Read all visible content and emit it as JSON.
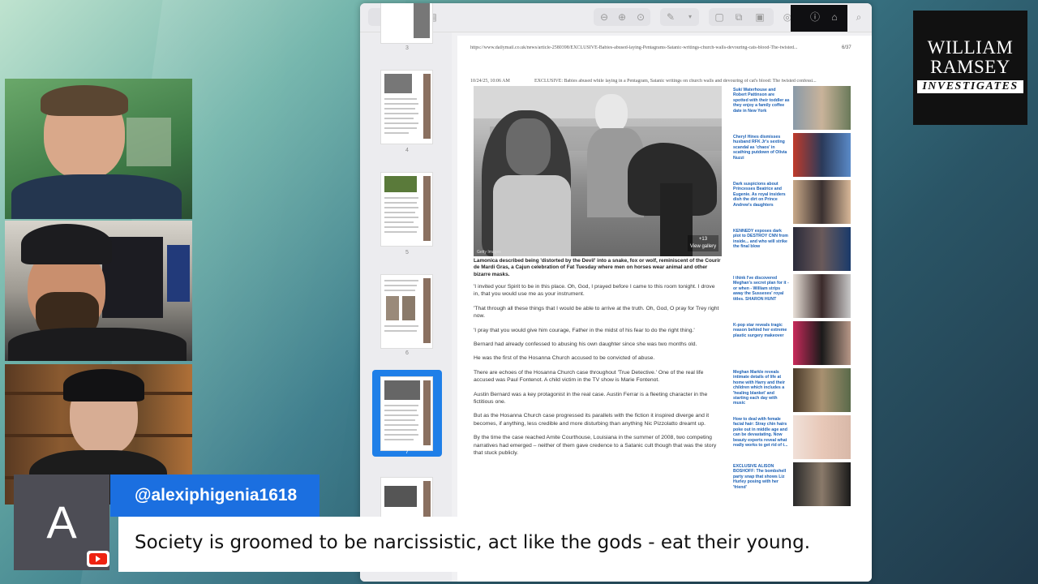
{
  "logo": {
    "line1": "WILLIAM",
    "line2": "RAMSEY",
    "line3": "INVESTIGATES"
  },
  "viewer": {
    "toolbar": {
      "icons": [
        "sidebar-icon",
        "view-menu-icon",
        "zoom-out-icon",
        "zoom-in-icon",
        "zoom-fit-icon",
        "pen-icon",
        "chevron-down-icon",
        "rotate-icon",
        "share-icon",
        "markup-icon",
        "info-icon",
        "export-icon",
        "search-icon"
      ]
    },
    "thumbnails": [
      {
        "page": "3"
      },
      {
        "page": "4"
      },
      {
        "page": "5"
      },
      {
        "page": "6"
      },
      {
        "page": "7",
        "selected": true
      },
      {
        "page": ""
      }
    ],
    "page": {
      "url": "https://www.dailymail.co.uk/news/article-2580398/EXCLUSIVE-Babies-abused-laying-Pentagrams-Satanic-writings-church-walls-devouring-cats-blood-The-twisted...",
      "page_count": "6/37",
      "date": "10/24/25, 10:06 AM",
      "title": "EXCLUSIVE: Babies abused while laying in a Pentagram, Satanic writings on church walls and devouring of cat's blood: The twisted confessi...",
      "photo_credit": "Getty Images",
      "photo_more": "+13",
      "photo_more_label": "View gallery",
      "caption": "Lamonica described being 'distorted by the Devil' into a snake, fox or wolf, reminiscent of the Courir de Mardi Gras, a Cajun celebration of Fat Tuesday where men on horses wear animal and other bizarre masks.",
      "paragraphs": [
        "'I invited your Spirit to be in this place. Oh, God, I prayed before I came to this room tonight. I drove in, that you would use me as your instrument.",
        "'That through all these things that I would be able to arrive at the truth. Oh, God, O pray for Trey right now.",
        "'I pray that you would give him courage, Father in the midst of his fear to do the right thing.'",
        "Bernard had already confessed to abusing his own daughter since she was two months old.",
        "He was the first of the Hosanna Church accused to be convicted of abuse.",
        "There are echoes of the Hosanna Church case throughout 'True Detective.' One of the real life accused was Paul Fontenot. A child victim in the TV show is Marie Fontenot.",
        "Austin Bernard was a key protagonist in the real case. Austin Ferrar is a fleeting character in the fictitious one.",
        "But as the Hosanna Church case progressed its parallels with the fiction it inspired diverge and it becomes, if anything, less credible and more disturbing than anything Nic Pizzolatto dreamt up.",
        "By the time the case reached Amite Courthouse, Louisiana in the summer of 2008, two competing narratives had emerged – neither of them gave credence to a Satanic cult though that was the story that stuck publicly."
      ],
      "sidebar_stories": [
        "Suki Waterhouse and Robert Pattinson are spotted with their toddler as they enjoy a family coffee date in New York",
        "Cheryl Hines dismisses husband RFK Jr's sexting scandal as 'chaos' in scathing putdown of Olivia Nuzzi",
        "Dark suspicions about Princesses Beatrice and Eugenie. As royal insiders dish the dirt on Prince Andrew's daughters",
        "KENNEDY exposes dark plot to DESTROY CNN from inside... and who will strike the final blow",
        "I think I've discovered Meghan's secret plan for it - or when - William strips away the Sussexes' royal titles. SHARON HUNT",
        "K-pop star reveals tragic reason behind her extreme plastic surgery makeover",
        "Meghan Markle reveals intimate details of life at home with Harry and their children which includes a 'healing blanket' and starting each day with music",
        "How to deal with female facial hair: Stray chin hairs poke out in middle age and can be devastating. Now beauty experts reveal what really works to get rid of t...",
        "EXCLUSIVE ALISON BOSHOFF: The bombshell party snap that shows Liz Hurley posing with her 'friend'"
      ]
    }
  },
  "chat": {
    "avatar_letter": "A",
    "username": "@alexiphigenia1618",
    "message": "Society is groomed to be narcissistic, act like the gods - eat their young."
  }
}
